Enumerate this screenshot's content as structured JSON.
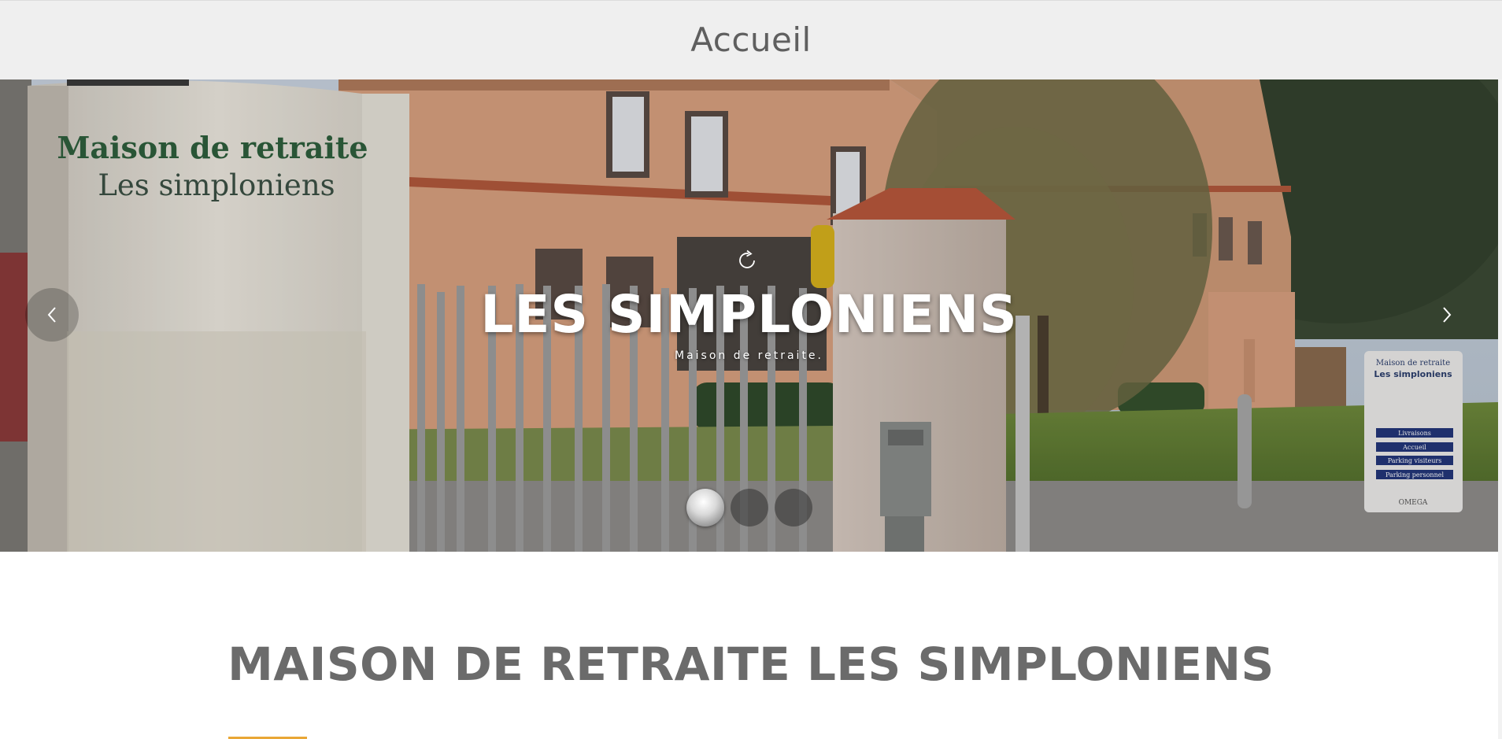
{
  "header": {
    "title": "Accueil"
  },
  "hero": {
    "title": "LES SIMPLONIENS",
    "subtitle": "Maison de retraite.",
    "sign_text": [
      "Maison de retraite",
      "Les simploniens"
    ],
    "small_sign": {
      "title": [
        "Maison de retraite",
        "Les simploniens"
      ],
      "items": [
        "Livraisons",
        "Accueil",
        "Parking visiteurs",
        "Parking personnel"
      ],
      "logo": "OMEGA"
    },
    "slides": {
      "count": 3,
      "active": 1
    }
  },
  "main": {
    "heading": "MAISON DE RETRAITE LES SIMPLONIENS"
  },
  "icons": {
    "reload": "reload-icon",
    "prev": "chevron-left-icon",
    "next": "chevron-right-icon"
  },
  "colors": {
    "header_bg": "#efefef",
    "header_text": "#5f5f5f",
    "heading_text": "#6b6b6b",
    "accent": "#e9a736"
  }
}
